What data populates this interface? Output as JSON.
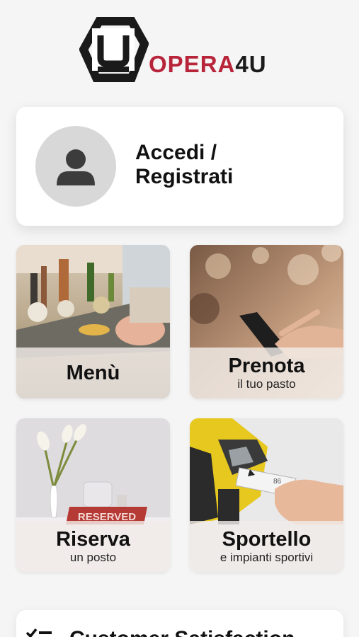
{
  "brand": {
    "logo_letter": "U",
    "name_main": "OPERA",
    "name_suffix": "4U",
    "accent": "#b8243a",
    "dark": "#1a1a1a"
  },
  "login": {
    "label_line1": "Accedi /",
    "label_line2": "Registrati",
    "icon": "user-icon"
  },
  "tiles": [
    {
      "title": "Menù",
      "subtitle": ""
    },
    {
      "title": "Prenota",
      "subtitle": "il tuo pasto"
    },
    {
      "title": "Riserva",
      "subtitle": "un posto",
      "sign_text": "RESERVED"
    },
    {
      "title": "Sportello",
      "subtitle": "e impianti sportivi",
      "ticket_text": "86"
    }
  ],
  "survey": {
    "label": "Customer Satisfaction",
    "icon": "checklist-icon"
  }
}
